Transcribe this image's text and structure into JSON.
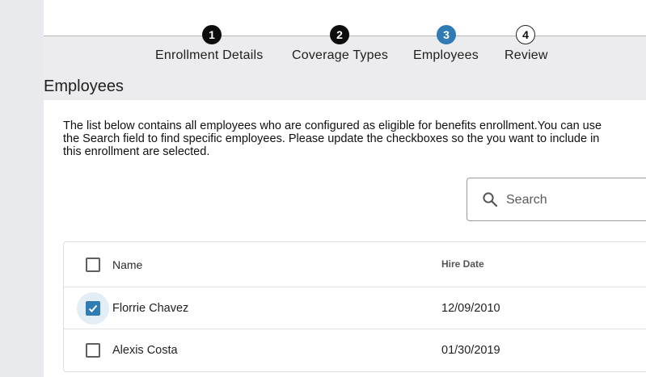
{
  "stepper": {
    "steps": [
      {
        "number": "1",
        "label": "Enrollment Details",
        "state": "done"
      },
      {
        "number": "2",
        "label": "Coverage Types",
        "state": "done"
      },
      {
        "number": "3",
        "label": "Employees",
        "state": "active"
      },
      {
        "number": "4",
        "label": "Review",
        "state": "todo"
      }
    ]
  },
  "section": {
    "title": "Employees"
  },
  "description": {
    "line1": "The list below contains all employees who are configured as eligible for benefits enrollment.You can use",
    "line2": "the Search field to find specific employees. Please update the checkboxes so the you want to include in",
    "line3": "this enrollment are selected."
  },
  "search": {
    "placeholder": "Search",
    "value": "",
    "icon": "search-icon"
  },
  "table": {
    "columns": {
      "name": "Name",
      "hire_date": "Hire Date"
    },
    "select_all_checked": false,
    "rows": [
      {
        "name": "Florrie Chavez",
        "hire_date": "12/09/2010",
        "checked": true
      },
      {
        "name": "Alexis Costa",
        "hire_date": "01/30/2019",
        "checked": false
      }
    ]
  },
  "colors": {
    "accent": "#2f7bb3",
    "completed_step": "#0d0d0d",
    "background": "#ececee"
  }
}
